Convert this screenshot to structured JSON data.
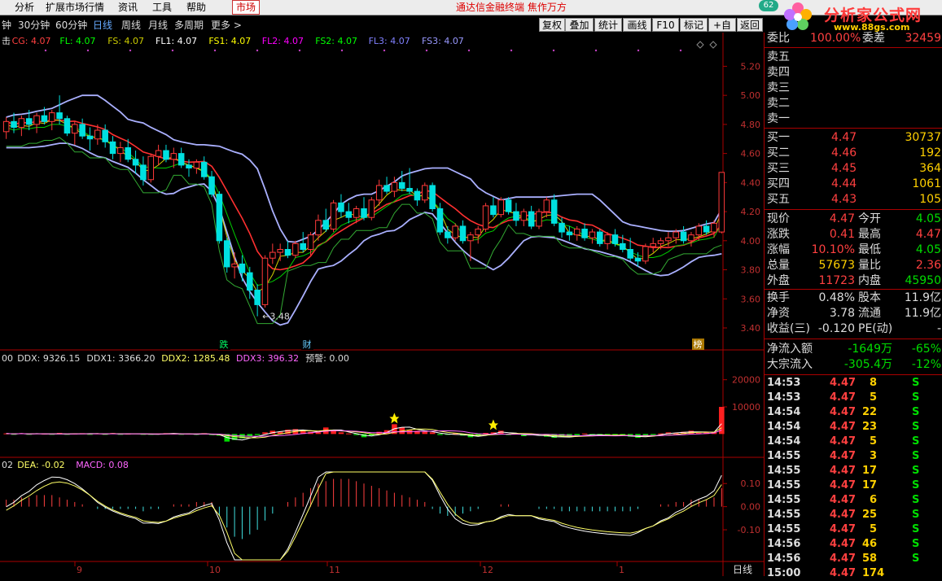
{
  "menu": {
    "items": [
      "分析",
      "扩展市场行情",
      "资讯",
      "工具",
      "帮助"
    ],
    "market": "市场",
    "promo": "通达信金融终端 焦作万方"
  },
  "logo": {
    "badge": "62",
    "brand": "分析家公式网",
    "url": "www.88gs.com"
  },
  "toolbar": {
    "periods": [
      "钟",
      "30分钟",
      "60分钟",
      "日线",
      "周线",
      "月线",
      "多周期",
      "更多 >"
    ],
    "active_period": "日线",
    "buttons": [
      "复权",
      "叠加",
      "统计",
      "画线",
      "F10",
      "标记",
      "+自选",
      "返回"
    ]
  },
  "indicators": {
    "main_legend": [
      {
        "t": "击",
        "c": "#dddddd"
      },
      {
        "t": "CG: 4.07",
        "c": "#ff4040"
      },
      {
        "t": "FL: 4.07",
        "c": "#00ff00"
      },
      {
        "t": "FS: 4.07",
        "c": "#cccc00"
      },
      {
        "t": "FL1: 4.07",
        "c": "#ffffff"
      },
      {
        "t": "FS1: 4.07",
        "c": "#ffff00"
      },
      {
        "t": "FL2: 4.07",
        "c": "#ff00ff"
      },
      {
        "t": "FS2: 4.07",
        "c": "#00ff00"
      },
      {
        "t": "FL3: 4.07",
        "c": "#8080ff"
      },
      {
        "t": "FS3: 4.07",
        "c": "#9999ff"
      }
    ],
    "ddx_legend": [
      {
        "t": "00",
        "c": "#dddddd"
      },
      {
        "t": "DDX: 9326.15",
        "c": "#dddddd"
      },
      {
        "t": "DDX1: 3366.20",
        "c": "#dddddd"
      },
      {
        "t": "DDX2: 1285.48",
        "c": "#ffff66"
      },
      {
        "t": "DDX3: 396.32",
        "c": "#ff66ff"
      },
      {
        "t": "预警: 0.00",
        "c": "#dddddd"
      }
    ],
    "macd_legend": [
      {
        "t": "02",
        "c": "#dddddd"
      },
      {
        "t": "DEA: -0.02",
        "c": "#ffff66"
      },
      {
        "t": "MACD: 0.08",
        "c": "#ff66ff"
      }
    ]
  },
  "chart_data": [
    {
      "type": "candlestick",
      "name": "price",
      "y_ticks": [
        "5.20",
        "5.00",
        "4.80",
        "4.60",
        "4.40",
        "4.20",
        "4.00",
        "3.80",
        "3.60",
        "3.40"
      ],
      "ylim": [
        3.26,
        5.32
      ],
      "annotations": [
        {
          "label": "3.48",
          "kind": "low-marker"
        },
        {
          "label": "跌",
          "kind": "tag"
        },
        {
          "label": "财",
          "kind": "tag"
        },
        {
          "label": "榜",
          "kind": "tag"
        }
      ],
      "candles": [
        [
          4.75,
          4.85,
          4.7,
          4.82
        ],
        [
          4.82,
          4.88,
          4.74,
          4.78
        ],
        [
          4.78,
          4.86,
          4.72,
          4.84
        ],
        [
          4.84,
          4.9,
          4.76,
          4.8
        ],
        [
          4.8,
          4.88,
          4.74,
          4.86
        ],
        [
          4.86,
          4.92,
          4.8,
          4.82
        ],
        [
          4.82,
          4.9,
          4.76,
          4.88
        ],
        [
          4.88,
          5.0,
          4.8,
          4.84
        ],
        [
          4.84,
          4.86,
          4.72,
          4.74
        ],
        [
          4.74,
          4.82,
          4.66,
          4.8
        ],
        [
          4.8,
          4.84,
          4.7,
          4.72
        ],
        [
          4.72,
          4.78,
          4.62,
          4.7
        ],
        [
          4.7,
          4.8,
          4.66,
          4.76
        ],
        [
          4.76,
          4.8,
          4.64,
          4.68
        ],
        [
          4.68,
          4.72,
          4.56,
          4.6
        ],
        [
          4.6,
          4.68,
          4.54,
          4.64
        ],
        [
          4.64,
          4.7,
          4.54,
          4.56
        ],
        [
          4.56,
          4.62,
          4.46,
          4.52
        ],
        [
          4.52,
          4.58,
          4.38,
          4.42
        ],
        [
          4.42,
          4.6,
          4.4,
          4.58
        ],
        [
          4.58,
          4.66,
          4.52,
          4.62
        ],
        [
          4.62,
          4.66,
          4.54,
          4.56
        ],
        [
          4.56,
          4.64,
          4.5,
          4.6
        ],
        [
          4.6,
          4.64,
          4.5,
          4.52
        ],
        [
          4.52,
          4.56,
          4.44,
          4.5
        ],
        [
          4.5,
          4.56,
          4.46,
          4.54
        ],
        [
          4.54,
          4.58,
          4.42,
          4.44
        ],
        [
          4.44,
          4.48,
          4.3,
          4.32
        ],
        [
          4.32,
          4.34,
          3.98,
          4.0
        ],
        [
          4.0,
          4.02,
          3.78,
          3.82
        ],
        [
          3.82,
          3.92,
          3.74,
          3.84
        ],
        [
          3.84,
          3.9,
          3.72,
          3.78
        ],
        [
          3.78,
          3.82,
          3.6,
          3.66
        ],
        [
          3.66,
          3.7,
          3.48,
          3.56
        ],
        [
          3.56,
          3.9,
          3.54,
          3.88
        ],
        [
          3.88,
          3.98,
          3.84,
          3.92
        ],
        [
          3.92,
          3.98,
          3.86,
          3.94
        ],
        [
          3.94,
          4.0,
          3.88,
          3.9
        ],
        [
          3.9,
          4.0,
          3.88,
          3.98
        ],
        [
          3.98,
          4.06,
          3.92,
          3.94
        ],
        [
          3.94,
          4.06,
          3.9,
          4.04
        ],
        [
          4.04,
          4.18,
          4.0,
          4.14
        ],
        [
          4.14,
          4.22,
          4.06,
          4.08
        ],
        [
          4.08,
          4.28,
          4.06,
          4.26
        ],
        [
          4.26,
          4.32,
          4.16,
          4.2
        ],
        [
          4.2,
          4.26,
          4.12,
          4.16
        ],
        [
          4.16,
          4.24,
          4.12,
          4.22
        ],
        [
          4.22,
          4.3,
          4.14,
          4.16
        ],
        [
          4.16,
          4.3,
          4.14,
          4.28
        ],
        [
          4.28,
          4.42,
          4.24,
          4.38
        ],
        [
          4.38,
          4.44,
          4.32,
          4.34
        ],
        [
          4.34,
          4.44,
          4.3,
          4.4
        ],
        [
          4.4,
          4.48,
          4.34,
          4.36
        ],
        [
          4.36,
          4.5,
          4.32,
          4.34
        ],
        [
          4.34,
          4.36,
          4.24,
          4.28
        ],
        [
          4.28,
          4.4,
          4.26,
          4.38
        ],
        [
          4.38,
          4.4,
          4.2,
          4.22
        ],
        [
          4.22,
          4.26,
          4.04,
          4.06
        ],
        [
          4.06,
          4.1,
          3.98,
          4.02
        ],
        [
          4.02,
          4.12,
          4.0,
          4.1
        ],
        [
          4.1,
          4.14,
          3.98,
          4.0
        ],
        [
          4.0,
          4.06,
          3.86,
          4.04
        ],
        [
          4.04,
          4.1,
          3.98,
          4.08
        ],
        [
          4.08,
          4.26,
          4.06,
          4.24
        ],
        [
          4.24,
          4.3,
          4.16,
          4.18
        ],
        [
          4.18,
          4.3,
          4.16,
          4.28
        ],
        [
          4.28,
          4.3,
          4.18,
          4.2
        ],
        [
          4.2,
          4.26,
          4.1,
          4.14
        ],
        [
          4.14,
          4.22,
          4.1,
          4.2
        ],
        [
          4.2,
          4.24,
          4.08,
          4.1
        ],
        [
          4.1,
          4.22,
          4.08,
          4.2
        ],
        [
          4.2,
          4.3,
          4.16,
          4.28
        ],
        [
          4.28,
          4.32,
          4.1,
          4.12
        ],
        [
          4.12,
          4.16,
          4.02,
          4.06
        ],
        [
          4.06,
          4.1,
          4.0,
          4.04
        ],
        [
          4.04,
          4.1,
          4.0,
          4.08
        ],
        [
          4.08,
          4.12,
          4.0,
          4.02
        ],
        [
          4.02,
          4.08,
          3.98,
          4.06
        ],
        [
          4.06,
          4.08,
          3.96,
          3.98
        ],
        [
          3.98,
          4.06,
          3.94,
          4.04
        ],
        [
          4.04,
          4.08,
          3.96,
          3.98
        ],
        [
          3.98,
          4.04,
          3.92,
          3.94
        ],
        [
          3.94,
          4.02,
          3.86,
          3.88
        ],
        [
          3.88,
          3.92,
          3.82,
          3.86
        ],
        [
          3.86,
          3.98,
          3.84,
          3.96
        ],
        [
          3.96,
          4.02,
          3.92,
          3.98
        ],
        [
          3.98,
          4.02,
          3.94,
          4.0
        ],
        [
          4.0,
          4.06,
          3.96,
          4.02
        ],
        [
          4.02,
          4.08,
          3.98,
          4.06
        ],
        [
          4.06,
          4.1,
          3.98,
          4.0
        ],
        [
          4.0,
          4.06,
          3.96,
          4.04
        ],
        [
          4.04,
          4.12,
          4.0,
          4.1
        ],
        [
          4.1,
          4.14,
          4.04,
          4.06
        ],
        [
          4.06,
          4.14,
          4.02,
          4.12
        ],
        [
          4.06,
          4.47,
          4.05,
          4.47
        ]
      ],
      "series": [
        {
          "color": "#ff3030"
        },
        {
          "color": "#00cc00"
        },
        {
          "color": "#d0d000"
        },
        {
          "color": "#9999ff"
        }
      ]
    },
    {
      "type": "bar",
      "name": "DDX",
      "y_ticks": [
        "20000",
        "10000"
      ],
      "ylim": [
        -8000,
        25000
      ],
      "values": [
        200,
        -150,
        300,
        -200,
        250,
        100,
        -300,
        400,
        -250,
        150,
        300,
        -100,
        200,
        -200,
        350,
        -150,
        100,
        250,
        -300,
        -200,
        150,
        300,
        200,
        -250,
        100,
        -200,
        300,
        -400,
        -600,
        -2800,
        -2200,
        -1600,
        -800,
        -400,
        600,
        1200,
        800,
        1600,
        1800,
        1000,
        800,
        600,
        2400,
        1400,
        600,
        200,
        -400,
        -1200,
        -600,
        800,
        1400,
        3600,
        2400,
        1600,
        1200,
        800,
        600,
        -400,
        -300,
        200,
        -600,
        -1200,
        -800,
        400,
        600,
        1200,
        -400,
        200,
        -800,
        -200,
        -600,
        -1000,
        -1400,
        -800,
        -1200,
        -600,
        200,
        -400,
        -600,
        -200,
        -800,
        -400,
        -1000,
        -1400,
        -600,
        -400,
        200,
        600,
        400,
        800,
        1200,
        400,
        600,
        800,
        10000
      ]
    },
    {
      "type": "bar",
      "name": "MACD",
      "y_ticks": [
        "0.10",
        "0.00",
        "-0.10"
      ],
      "ylim": [
        -0.23,
        0.15
      ],
      "values": [
        0.03,
        0.03,
        0.04,
        0.04,
        0.05,
        0.05,
        0.05,
        0.04,
        0.03,
        0.02,
        0.01,
        0.0,
        -0.01,
        -0.01,
        -0.01,
        -0.01,
        -0.01,
        -0.01,
        -0.02,
        -0.01,
        -0.01,
        0.0,
        0.01,
        0.01,
        0.01,
        0.02,
        0.02,
        0.02,
        -0.04,
        -0.09,
        -0.13,
        -0.14,
        -0.12,
        -0.1,
        -0.06,
        -0.03,
        0.0,
        0.02,
        0.04,
        0.06,
        0.08,
        0.1,
        0.11,
        0.12,
        0.12,
        0.12,
        0.11,
        0.1,
        0.09,
        0.08,
        0.07,
        0.06,
        0.05,
        0.04,
        0.03,
        0.02,
        -0.01,
        -0.03,
        -0.04,
        -0.04,
        -0.03,
        -0.02,
        -0.01,
        0.0,
        0.0,
        0.01,
        0.01,
        0.0,
        0.0,
        0.0,
        -0.01,
        -0.01,
        -0.01,
        -0.02,
        -0.02,
        -0.02,
        -0.02,
        -0.02,
        -0.02,
        -0.02,
        -0.02,
        -0.02,
        -0.02,
        -0.01,
        0.0,
        0.0,
        0.01,
        0.01,
        0.02,
        0.02,
        0.03,
        0.03,
        0.03,
        0.04,
        0.08
      ]
    }
  ],
  "x_axis": {
    "labels": [
      "9",
      "10",
      "11",
      "12",
      "1"
    ],
    "period_label": "日线"
  },
  "quote": {
    "top": {
      "label": "委比",
      "value": "100.00%",
      "label2": "委差",
      "value2": "32459"
    },
    "asks": [
      "卖五",
      "卖四",
      "卖三",
      "卖二",
      "卖一"
    ],
    "bids": [
      {
        "label": "买一",
        "price": "4.47",
        "vol": "30737"
      },
      {
        "label": "买二",
        "price": "4.46",
        "vol": "192"
      },
      {
        "label": "买三",
        "price": "4.45",
        "vol": "364"
      },
      {
        "label": "买四",
        "price": "4.44",
        "vol": "1061"
      },
      {
        "label": "买五",
        "price": "4.43",
        "vol": "105"
      }
    ],
    "stats": [
      {
        "l1": "现价",
        "v1": "4.47",
        "c1": "#ff4040",
        "l2": "今开",
        "v2": "4.05",
        "c2": "#00dd00"
      },
      {
        "l1": "涨跌",
        "v1": "0.41",
        "c1": "#ff4040",
        "l2": "最高",
        "v2": "4.47",
        "c2": "#ff4040"
      },
      {
        "l1": "涨幅",
        "v1": "10.10%",
        "c1": "#ff4040",
        "l2": "最低",
        "v2": "4.05",
        "c2": "#00dd00"
      },
      {
        "l1": "总量",
        "v1": "57673",
        "c1": "#ffd000",
        "l2": "量比",
        "v2": "2.36",
        "c2": "#ff4040"
      },
      {
        "l1": "外盘",
        "v1": "11723",
        "c1": "#ff4040",
        "l2": "内盘",
        "v2": "45950",
        "c2": "#00dd00"
      },
      {
        "l1": "换手",
        "v1": "0.48%",
        "c1": "#dddddd",
        "l2": "股本",
        "v2": "11.9亿",
        "c2": "#dddddd"
      },
      {
        "l1": "净资",
        "v1": "3.78",
        "c1": "#dddddd",
        "l2": "流通",
        "v2": "11.9亿",
        "c2": "#dddddd"
      },
      {
        "l1": "收益(三)",
        "v1": "-0.120",
        "c1": "#dddddd",
        "l2": "PE(动)",
        "v2": "-",
        "c2": "#dddddd"
      }
    ],
    "flows": [
      {
        "label": "净流入额",
        "v1": "-1649万",
        "v2": "-65%"
      },
      {
        "label": "大宗流入",
        "v1": "-305.4万",
        "v2": "-12%"
      }
    ],
    "ticks": [
      [
        "14:53",
        "4.47",
        "8",
        "S"
      ],
      [
        "14:53",
        "4.47",
        "5",
        "S"
      ],
      [
        "14:54",
        "4.47",
        "22",
        "S"
      ],
      [
        "14:54",
        "4.47",
        "23",
        "S"
      ],
      [
        "14:54",
        "4.47",
        "5",
        "S"
      ],
      [
        "14:55",
        "4.47",
        "3",
        "S"
      ],
      [
        "14:55",
        "4.47",
        "17",
        "S"
      ],
      [
        "14:55",
        "4.47",
        "17",
        "S"
      ],
      [
        "14:55",
        "4.47",
        "6",
        "S"
      ],
      [
        "14:55",
        "4.47",
        "25",
        "S"
      ],
      [
        "14:55",
        "4.47",
        "5",
        "S"
      ],
      [
        "14:56",
        "4.47",
        "46",
        "S"
      ],
      [
        "14:56",
        "4.47",
        "58",
        "S"
      ],
      [
        "15:00",
        "4.47",
        "174",
        ""
      ]
    ]
  }
}
